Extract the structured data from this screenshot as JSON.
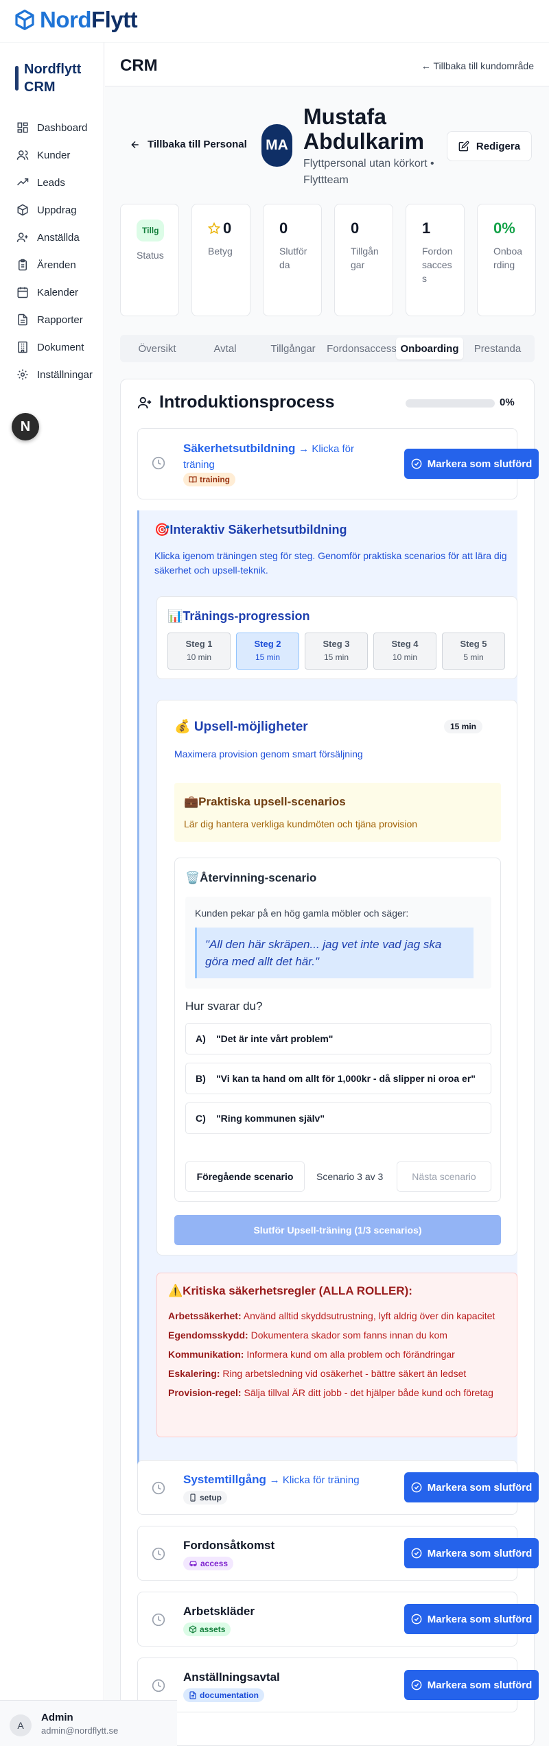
{
  "top_brand": {
    "part1": "Nord",
    "part2": "Flytt"
  },
  "sidebar": {
    "logo_text": "Nordflytt CRM",
    "items": [
      {
        "label": "Dashboard",
        "icon": "dashboard-icon"
      },
      {
        "label": "Kunder",
        "icon": "users-icon"
      },
      {
        "label": "Leads",
        "icon": "trending-icon"
      },
      {
        "label": "Uppdrag",
        "icon": "package-icon"
      },
      {
        "label": "Anställda",
        "icon": "user-plus-icon"
      },
      {
        "label": "Ärenden",
        "icon": "clipboard-icon"
      },
      {
        "label": "Kalender",
        "icon": "calendar-icon"
      },
      {
        "label": "Rapporter",
        "icon": "file-icon"
      },
      {
        "label": "Dokument",
        "icon": "building-icon"
      },
      {
        "label": "Inställningar",
        "icon": "settings-icon"
      }
    ],
    "fab_letter": "N",
    "user": {
      "initial": "A",
      "name": "Admin",
      "email": "admin@nordflytt.se"
    }
  },
  "header": {
    "title": "CRM",
    "back_link": "← Tillbaka till kundområde"
  },
  "profile": {
    "back_label": "Tillbaka till Personal",
    "initials": "MA",
    "name": "Mustafa Abdulkarim",
    "subtitle": "Flyttpersonal utan körkort • Flyttteam",
    "edit_label": "Redigera"
  },
  "stats": [
    {
      "value": "Tillg",
      "label": "Status",
      "type": "badge"
    },
    {
      "value": "0",
      "label": "Betyg",
      "type": "star"
    },
    {
      "value": "0",
      "label": "Slutförda"
    },
    {
      "value": "0",
      "label": "Tillgångar"
    },
    {
      "value": "1",
      "label": "Fordonsaccess"
    },
    {
      "value": "0%",
      "label": "Onboarding",
      "color": "#16a34a"
    }
  ],
  "tabs": [
    "Översikt",
    "Avtal",
    "Tillgångar",
    "Fordonsaccess",
    "Onboarding",
    "Prestanda"
  ],
  "active_tab": "Onboarding",
  "intro": {
    "title": "Introduktionsprocess",
    "progress_pct": "0%",
    "progress": 0
  },
  "tasks": [
    {
      "name": "Säkerhetsutbildning",
      "link": "→ Klicka för träning",
      "tag": "training",
      "tag_icon": "book-icon",
      "button": "Markera som slutförd"
    },
    {
      "name": "Systemtillgång",
      "link": "→ Klicka för träning",
      "tag": "setup",
      "tag_icon": "phone-icon",
      "button": "Markera som slutförd"
    },
    {
      "name": "Fordonsåtkomst",
      "link": "",
      "tag": "access",
      "tag_icon": "car-icon",
      "button": "Markera som slutförd"
    },
    {
      "name": "Arbetskläder",
      "link": "",
      "tag": "assets",
      "tag_icon": "package-icon",
      "button": "Markera som slutförd"
    },
    {
      "name": "Anställningsavtal",
      "link": "",
      "tag": "documentation",
      "tag_icon": "document-icon",
      "button": "Markera som slutförd"
    }
  ],
  "training": {
    "title": "🎯Interaktiv Säkerhetsutbildning",
    "desc": "Klicka igenom träningen steg för steg. Genomför praktiska scenarios för att lära dig säkerhet och upsell-teknik.",
    "progress_title": "📊Tränings-progression",
    "steps": [
      {
        "name": "Steg 1",
        "min": "10 min"
      },
      {
        "name": "Steg 2",
        "min": "15 min"
      },
      {
        "name": "Steg 3",
        "min": "15 min"
      },
      {
        "name": "Steg 4",
        "min": "10 min"
      },
      {
        "name": "Steg 5",
        "min": "5 min"
      }
    ],
    "active_step": 1
  },
  "upsell": {
    "title": "💰 Upsell-möjligheter",
    "minutes": "15 min",
    "desc": "Maximera provision genom smart försäljning",
    "scenarios_title": "💼Praktiska upsell-scenarios",
    "scenarios_desc": "Lär dig hantera verkliga kundmöten och tjäna provision",
    "scenario": {
      "title": "🗑️Återvinning-scenario",
      "prompt": "Kunden pekar på en hög gamla möbler och säger:",
      "quote": "\"All den här skräpen... jag vet inte vad jag ska göra med allt det här.\"",
      "question": "Hur svarar du?",
      "options": [
        {
          "letter": "A)",
          "text": "\"Det är inte vårt problem\""
        },
        {
          "letter": "B)",
          "text": "\"Vi kan ta hand om allt för 1,000kr - då slipper ni oroa er\""
        },
        {
          "letter": "C)",
          "text": "\"Ring kommunen själv\""
        }
      ],
      "prev": "Föregående scenario",
      "position": "Scenario 3 av 3",
      "next": "Nästa scenario"
    },
    "finish": "Slutför Upsell-träning (1/3 scenarios)"
  },
  "safety": {
    "title": "⚠️Kritiska säkerhetsregler (ALLA ROLLER):",
    "rules": [
      {
        "k": "Arbetssäkerhet:",
        "v": "Använd alltid skyddsutrustning, lyft aldrig över din kapacitet"
      },
      {
        "k": "Egendomsskydd:",
        "v": "Dokumentera skador som fanns innan du kom"
      },
      {
        "k": "Kommunikation:",
        "v": "Informera kund om alla problem och förändringar"
      },
      {
        "k": "Eskalering:",
        "v": "Ring arbetsledning vid osäkerhet - bättre säkert än ledset"
      },
      {
        "k": "Provision-regel:",
        "v": "Sälja tillval ÄR ditt jobb - det hjälper både kund och företag"
      }
    ]
  },
  "colors": {
    "primary": "#2563eb",
    "brand_dark": "#0f2f66",
    "brand_light": "#1f74d6"
  }
}
